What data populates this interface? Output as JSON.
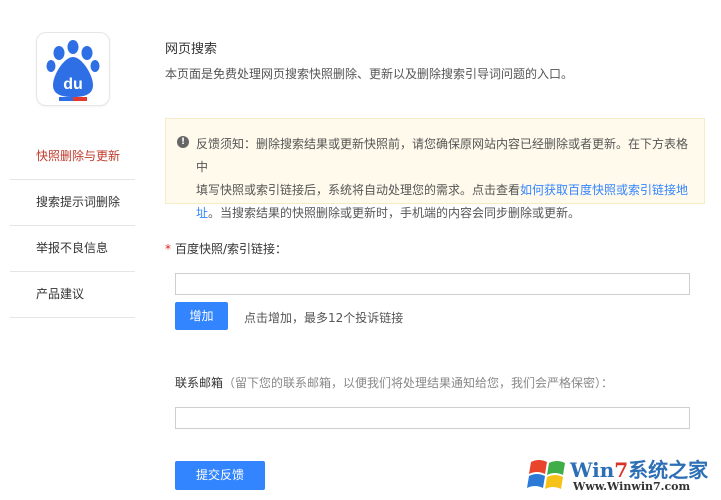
{
  "header": {
    "title": "网页搜索",
    "description": "本页面是免费处理网页搜索快照删除、更新以及删除搜索引导词问题的入口。"
  },
  "sidebar": {
    "items": [
      {
        "label": "快照删除与更新",
        "active": true
      },
      {
        "label": "搜索提示词删除",
        "active": false
      },
      {
        "label": "举报不良信息",
        "active": false
      },
      {
        "label": "产品建议",
        "active": false
      }
    ]
  },
  "notice": {
    "icon": "exclamation-icon",
    "line1": "反馈须知：删除搜索结果或更新快照前，请您确保原网站内容已经删除或者更新。在下方表格中",
    "line2_before": "填写快照或索引链接后，系统将自动处理您的需求。点击查看",
    "link_part1": "如何获取百度快照或索引链接地",
    "link_part2": "址",
    "line3_after": "。当搜索结果的快照删除或更新时，手机端的内容会同步删除或更新。"
  },
  "form": {
    "required_mark": "*",
    "link_label": "百度快照/索引链接：",
    "link_value": "",
    "add_button": "增加",
    "add_hint": "点击增加，最多12个投诉链接",
    "email_label": "联系邮箱",
    "email_hint": "（留下您的联系邮箱，以便我们将处理结果通知给您，我们会严格保密）：",
    "email_value": "",
    "submit_button": "提交反馈"
  },
  "logo": {
    "text": "du"
  },
  "watermark": {
    "brand_prefix": "Win",
    "brand_seven": "7",
    "brand_suffix": "系统之家",
    "url": "Www.Winwin7.com"
  },
  "colors": {
    "accent": "#3385ff",
    "active": "#c03a2b",
    "logo_blue": "#2f6fe5",
    "logo_red": "#e23a2e"
  }
}
